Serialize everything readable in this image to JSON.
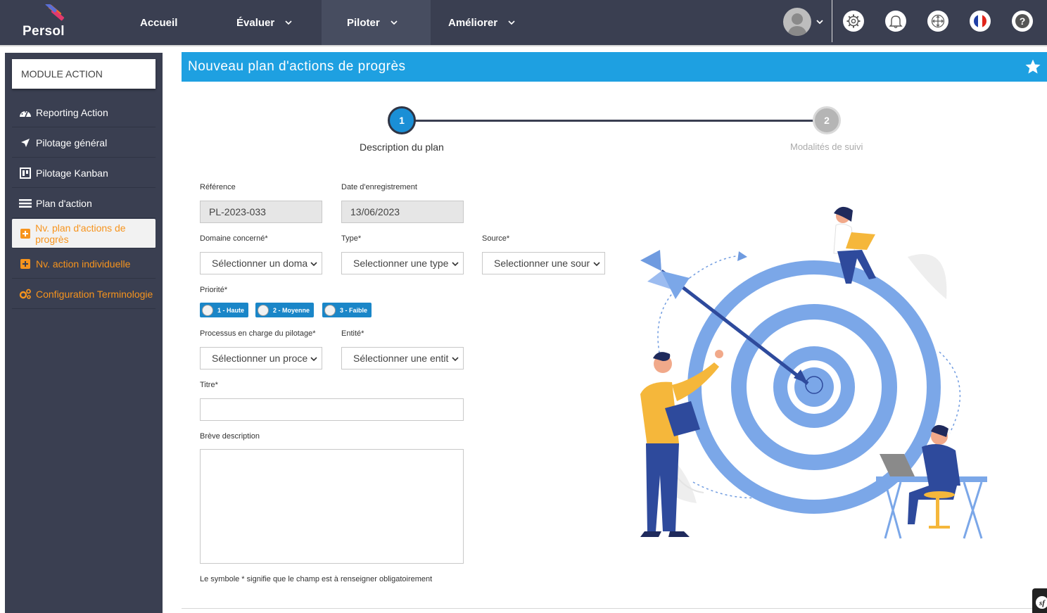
{
  "brand": {
    "name": "Persol"
  },
  "nav": {
    "items": [
      {
        "label": "Accueil"
      },
      {
        "label": "Évaluer"
      },
      {
        "label": "Piloter"
      },
      {
        "label": "Améliorer"
      }
    ]
  },
  "header_icons": [
    "user-avatar",
    "settings-icon",
    "bell-icon",
    "move-icon",
    "flag-fr-icon",
    "help-icon"
  ],
  "sidebar": {
    "module_title": "MODULE ACTION",
    "items": [
      {
        "label": "Reporting Action",
        "icon": "dashboard-icon"
      },
      {
        "label": "Pilotage général",
        "icon": "plane-icon"
      },
      {
        "label": "Pilotage Kanban",
        "icon": "kanban-icon"
      },
      {
        "label": "Plan d'action",
        "icon": "list-icon"
      },
      {
        "label": "Nv. plan d'actions de progrès",
        "icon": "plus-square-icon"
      },
      {
        "label": "Nv. action individuelle",
        "icon": "plus-square-icon"
      },
      {
        "label": "Configuration Terminologie",
        "icon": "gears-icon"
      }
    ]
  },
  "page": {
    "title": "Nouveau plan d'actions de progrès"
  },
  "stepper": {
    "steps": [
      {
        "number": "1",
        "label": "Description du plan"
      },
      {
        "number": "2",
        "label": "Modalités de suivi"
      }
    ],
    "current_step": 1
  },
  "form": {
    "reference": {
      "label": "Référence",
      "value": "PL-2023-033"
    },
    "date": {
      "label": "Date d'enregistrement",
      "value": "13/06/2023"
    },
    "domaine": {
      "label": "Domaine concerné*",
      "value": "Sélectionner un doma"
    },
    "type": {
      "label": "Type*",
      "value": "Selectionner une type"
    },
    "source": {
      "label": "Source*",
      "value": "Selectionner une sour"
    },
    "priorite": {
      "label": "Priorité*",
      "options": [
        "1 - Haute",
        "2 - Moyenne",
        "3 - Faible"
      ]
    },
    "processus": {
      "label": "Processus en charge du pilotage*",
      "value": "Sélectionner un proce"
    },
    "entite": {
      "label": "Entité*",
      "value": "Sélectionner une entit"
    },
    "titre": {
      "label": "Titre*",
      "value": ""
    },
    "description": {
      "label": "Brève description",
      "value": ""
    },
    "required_note": "Le symbole * signifie que le champ est à renseigner obligatoirement"
  },
  "colors": {
    "topbar": "#3a3f51",
    "header": "#1ea0e1",
    "accent_orange": "#f7941d",
    "radio_blue": "#1a86c8"
  }
}
